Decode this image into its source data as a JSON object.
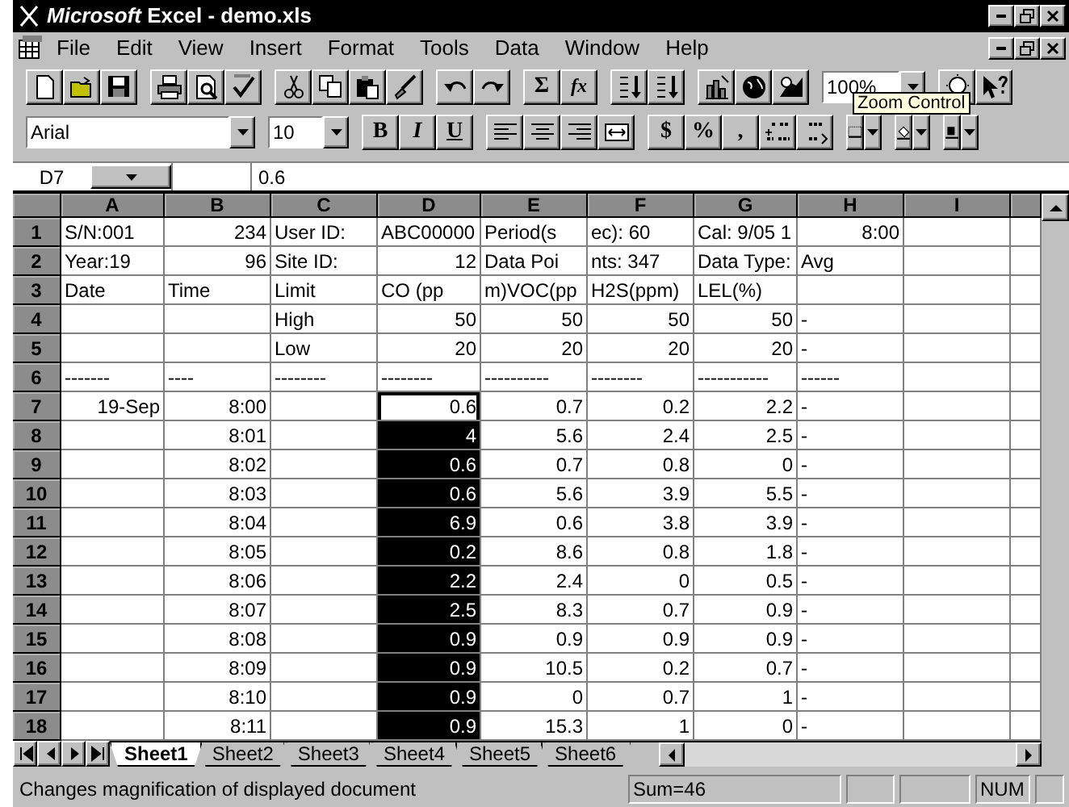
{
  "window": {
    "title": "*Microsoft* Excel - demo.xls"
  },
  "menu": [
    {
      "label": "File"
    },
    {
      "label": "Edit"
    },
    {
      "label": "View"
    },
    {
      "label": "Insert"
    },
    {
      "label": "Format"
    },
    {
      "label": "Tools"
    },
    {
      "label": "Data"
    },
    {
      "label": "Window"
    },
    {
      "label": "Help"
    }
  ],
  "standard_toolbar": {
    "sum_button": "Σ",
    "function_button": "fx",
    "zoom_box": "100%",
    "tooltip": "Zoom Control"
  },
  "formatting_toolbar": {
    "font_box": "Arial",
    "size_box": "10",
    "bold_button": "B",
    "italic_button": "I",
    "underline_button": "U",
    "currency_button": "$",
    "percent_button": "%",
    "comma_button": ","
  },
  "formula_bar": {
    "name_box": "D7",
    "value": "0.6"
  },
  "columns": [
    "A",
    "B",
    "C",
    "D",
    "E",
    "F",
    "G",
    "H",
    "I"
  ],
  "rows": [
    {
      "header": "1",
      "cells": [
        {
          "text": "S/N:001",
          "right": false,
          "selected": false,
          "active": false
        },
        {
          "text": "234",
          "right": true,
          "selected": false,
          "active": false
        },
        {
          "text": "User ID:",
          "right": false,
          "selected": false,
          "active": false
        },
        {
          "text": "ABC00000",
          "right": false,
          "selected": false,
          "active": false
        },
        {
          "text": "Period(s",
          "right": false,
          "selected": false,
          "active": false
        },
        {
          "text": "ec):  60",
          "right": false,
          "selected": false,
          "active": false
        },
        {
          "text": "Cal: 9/05 1",
          "right": false,
          "selected": false,
          "active": false
        },
        {
          "text": "8:00",
          "right": true,
          "selected": false,
          "active": false
        }
      ]
    },
    {
      "header": "2",
      "cells": [
        {
          "text": "Year:19",
          "right": false,
          "selected": false,
          "active": false
        },
        {
          "text": "96",
          "right": true,
          "selected": false,
          "active": false
        },
        {
          "text": "Site ID:",
          "right": false,
          "selected": false,
          "active": false
        },
        {
          "text": "12",
          "right": true,
          "selected": false,
          "active": false
        },
        {
          "text": "Data Poi",
          "right": false,
          "selected": false,
          "active": false
        },
        {
          "text": "nts: 347",
          "right": false,
          "selected": false,
          "active": false
        },
        {
          "text": "Data Type:",
          "right": false,
          "selected": false,
          "active": false
        },
        {
          "text": "Avg",
          "right": false,
          "selected": false,
          "active": false
        }
      ]
    },
    {
      "header": "3",
      "cells": [
        {
          "text": "Date",
          "right": false,
          "selected": false,
          "active": false
        },
        {
          "text": "Time",
          "right": false,
          "selected": false,
          "active": false
        },
        {
          "text": "Limit",
          "right": false,
          "selected": false,
          "active": false
        },
        {
          "text": "CO (pp",
          "right": false,
          "selected": false,
          "active": false
        },
        {
          "text": "m)VOC(pp",
          "right": false,
          "selected": false,
          "active": false
        },
        {
          "text": "H2S(ppm)",
          "right": false,
          "selected": false,
          "active": false
        },
        {
          "text": "LEL(%)",
          "right": false,
          "selected": false,
          "active": false
        },
        {
          "selected": false,
          "active": false
        }
      ]
    },
    {
      "header": "4",
      "cells": [
        {
          "selected": false,
          "active": false
        },
        {
          "selected": false,
          "active": false
        },
        {
          "text": "High",
          "right": false,
          "selected": false,
          "active": false
        },
        {
          "text": "50",
          "right": true,
          "selected": false,
          "active": false
        },
        {
          "text": "50",
          "right": true,
          "selected": false,
          "active": false
        },
        {
          "text": "50",
          "right": true,
          "selected": false,
          "active": false
        },
        {
          "text": "50",
          "right": true,
          "selected": false,
          "active": false
        },
        {
          "text": "-",
          "right": false,
          "selected": false,
          "active": false
        }
      ]
    },
    {
      "header": "5",
      "cells": [
        {
          "selected": false,
          "active": false
        },
        {
          "selected": false,
          "active": false
        },
        {
          "text": "Low",
          "right": false,
          "selected": false,
          "active": false
        },
        {
          "text": "20",
          "right": true,
          "selected": false,
          "active": false
        },
        {
          "text": "20",
          "right": true,
          "selected": false,
          "active": false
        },
        {
          "text": "20",
          "right": true,
          "selected": false,
          "active": false
        },
        {
          "text": "20",
          "right": true,
          "selected": false,
          "active": false
        },
        {
          "text": "-",
          "right": false,
          "selected": false,
          "active": false
        }
      ]
    },
    {
      "header": "6",
      "cells": [
        {
          "text": "-------",
          "right": false,
          "selected": false,
          "active": false
        },
        {
          "text": "----",
          "right": false,
          "selected": false,
          "active": false
        },
        {
          "text": "--------",
          "right": false,
          "selected": false,
          "active": false
        },
        {
          "text": "--------",
          "right": false,
          "selected": false,
          "active": false
        },
        {
          "text": "----------",
          "right": false,
          "selected": false,
          "active": false
        },
        {
          "text": "--------",
          "right": false,
          "selected": false,
          "active": false
        },
        {
          "text": "-----------",
          "right": false,
          "selected": false,
          "active": false
        },
        {
          "text": "------",
          "right": false,
          "selected": false,
          "active": false
        }
      ]
    },
    {
      "header": "7",
      "cells": [
        {
          "text": "19-Sep",
          "right": true,
          "selected": false,
          "active": false
        },
        {
          "text": "8:00",
          "right": true,
          "selected": false,
          "active": false
        },
        {
          "selected": false,
          "active": false
        },
        {
          "text": "0.6",
          "right": true,
          "selected": true,
          "active": true
        },
        {
          "text": "0.7",
          "right": true,
          "selected": false,
          "active": false
        },
        {
          "text": "0.2",
          "right": true,
          "selected": false,
          "active": false
        },
        {
          "text": "2.2",
          "right": true,
          "selected": false,
          "active": false
        },
        {
          "text": "-",
          "right": false,
          "selected": false,
          "active": false
        }
      ]
    },
    {
      "header": "8",
      "cells": [
        {
          "selected": false,
          "active": false
        },
        {
          "text": "8:01",
          "right": true,
          "selected": false,
          "active": false
        },
        {
          "selected": false,
          "active": false
        },
        {
          "text": "4",
          "right": true,
          "selected": true,
          "active": false
        },
        {
          "text": "5.6",
          "right": true,
          "selected": false,
          "active": false
        },
        {
          "text": "2.4",
          "right": true,
          "selected": false,
          "active": false
        },
        {
          "text": "2.5",
          "right": true,
          "selected": false,
          "active": false
        },
        {
          "text": "-",
          "right": false,
          "selected": false,
          "active": false
        }
      ]
    },
    {
      "header": "9",
      "cells": [
        {
          "selected": false,
          "active": false
        },
        {
          "text": "8:02",
          "right": true,
          "selected": false,
          "active": false
        },
        {
          "selected": false,
          "active": false
        },
        {
          "text": "0.6",
          "right": true,
          "selected": true,
          "active": false
        },
        {
          "text": "0.7",
          "right": true,
          "selected": false,
          "active": false
        },
        {
          "text": "0.8",
          "right": true,
          "selected": false,
          "active": false
        },
        {
          "text": "0",
          "right": true,
          "selected": false,
          "active": false
        },
        {
          "text": "-",
          "right": false,
          "selected": false,
          "active": false
        }
      ]
    },
    {
      "header": "10",
      "cells": [
        {
          "selected": false,
          "active": false
        },
        {
          "text": "8:03",
          "right": true,
          "selected": false,
          "active": false
        },
        {
          "selected": false,
          "active": false
        },
        {
          "text": "0.6",
          "right": true,
          "selected": true,
          "active": false
        },
        {
          "text": "5.6",
          "right": true,
          "selected": false,
          "active": false
        },
        {
          "text": "3.9",
          "right": true,
          "selected": false,
          "active": false
        },
        {
          "text": "5.5",
          "right": true,
          "selected": false,
          "active": false
        },
        {
          "text": "-",
          "right": false,
          "selected": false,
          "active": false
        }
      ]
    },
    {
      "header": "11",
      "cells": [
        {
          "selected": false,
          "active": false
        },
        {
          "text": "8:04",
          "right": true,
          "selected": false,
          "active": false
        },
        {
          "selected": false,
          "active": false
        },
        {
          "text": "6.9",
          "right": true,
          "selected": true,
          "active": false
        },
        {
          "text": "0.6",
          "right": true,
          "selected": false,
          "active": false
        },
        {
          "text": "3.8",
          "right": true,
          "selected": false,
          "active": false
        },
        {
          "text": "3.9",
          "right": true,
          "selected": false,
          "active": false
        },
        {
          "text": "-",
          "right": false,
          "selected": false,
          "active": false
        }
      ]
    },
    {
      "header": "12",
      "cells": [
        {
          "selected": false,
          "active": false
        },
        {
          "text": "8:05",
          "right": true,
          "selected": false,
          "active": false
        },
        {
          "selected": false,
          "active": false
        },
        {
          "text": "0.2",
          "right": true,
          "selected": true,
          "active": false
        },
        {
          "text": "8.6",
          "right": true,
          "selected": false,
          "active": false
        },
        {
          "text": "0.8",
          "right": true,
          "selected": false,
          "active": false
        },
        {
          "text": "1.8",
          "right": true,
          "selected": false,
          "active": false
        },
        {
          "text": "-",
          "right": false,
          "selected": false,
          "active": false
        }
      ]
    },
    {
      "header": "13",
      "cells": [
        {
          "selected": false,
          "active": false
        },
        {
          "text": "8:06",
          "right": true,
          "selected": false,
          "active": false
        },
        {
          "selected": false,
          "active": false
        },
        {
          "text": "2.2",
          "right": true,
          "selected": true,
          "active": false
        },
        {
          "text": "2.4",
          "right": true,
          "selected": false,
          "active": false
        },
        {
          "text": "0",
          "right": true,
          "selected": false,
          "active": false
        },
        {
          "text": "0.5",
          "right": true,
          "selected": false,
          "active": false
        },
        {
          "text": "-",
          "right": false,
          "selected": false,
          "active": false
        }
      ]
    },
    {
      "header": "14",
      "cells": [
        {
          "selected": false,
          "active": false
        },
        {
          "text": "8:07",
          "right": true,
          "selected": false,
          "active": false
        },
        {
          "selected": false,
          "active": false
        },
        {
          "text": "2.5",
          "right": true,
          "selected": true,
          "active": false
        },
        {
          "text": "8.3",
          "right": true,
          "selected": false,
          "active": false
        },
        {
          "text": "0.7",
          "right": true,
          "selected": false,
          "active": false
        },
        {
          "text": "0.9",
          "right": true,
          "selected": false,
          "active": false
        },
        {
          "text": "-",
          "right": false,
          "selected": false,
          "active": false
        }
      ]
    },
    {
      "header": "15",
      "cells": [
        {
          "selected": false,
          "active": false
        },
        {
          "text": "8:08",
          "right": true,
          "selected": false,
          "active": false
        },
        {
          "selected": false,
          "active": false
        },
        {
          "text": "0.9",
          "right": true,
          "selected": true,
          "active": false
        },
        {
          "text": "0.9",
          "right": true,
          "selected": false,
          "active": false
        },
        {
          "text": "0.9",
          "right": true,
          "selected": false,
          "active": false
        },
        {
          "text": "0.9",
          "right": true,
          "selected": false,
          "active": false
        },
        {
          "text": "-",
          "right": false,
          "selected": false,
          "active": false
        }
      ]
    },
    {
      "header": "16",
      "cells": [
        {
          "selected": false,
          "active": false
        },
        {
          "text": "8:09",
          "right": true,
          "selected": false,
          "active": false
        },
        {
          "selected": false,
          "active": false
        },
        {
          "text": "0.9",
          "right": true,
          "selected": true,
          "active": false
        },
        {
          "text": "10.5",
          "right": true,
          "selected": false,
          "active": false
        },
        {
          "text": "0.2",
          "right": true,
          "selected": false,
          "active": false
        },
        {
          "text": "0.7",
          "right": true,
          "selected": false,
          "active": false
        },
        {
          "text": "-",
          "right": false,
          "selected": false,
          "active": false
        }
      ]
    },
    {
      "header": "17",
      "cells": [
        {
          "selected": false,
          "active": false
        },
        {
          "text": "8:10",
          "right": true,
          "selected": false,
          "active": false
        },
        {
          "selected": false,
          "active": false
        },
        {
          "text": "0.9",
          "right": true,
          "selected": true,
          "active": false
        },
        {
          "text": "0",
          "right": true,
          "selected": false,
          "active": false
        },
        {
          "text": "0.7",
          "right": true,
          "selected": false,
          "active": false
        },
        {
          "text": "1",
          "right": true,
          "selected": false,
          "active": false
        },
        {
          "text": "-",
          "right": false,
          "selected": false,
          "active": false
        }
      ]
    },
    {
      "header": "18",
      "cells": [
        {
          "selected": false,
          "active": false
        },
        {
          "text": "8:11",
          "right": true,
          "selected": false,
          "active": false
        },
        {
          "selected": false,
          "active": false
        },
        {
          "text": "0.9",
          "right": true,
          "selected": true,
          "active": false
        },
        {
          "text": "15.3",
          "right": true,
          "selected": false,
          "active": false
        },
        {
          "text": "1",
          "right": true,
          "selected": false,
          "active": false
        },
        {
          "text": "0",
          "right": true,
          "selected": false,
          "active": false
        },
        {
          "text": "-",
          "right": false,
          "selected": false,
          "active": false
        }
      ]
    }
  ],
  "sheet_tabs": [
    {
      "label": "Sheet1",
      "selected": true
    },
    {
      "label": "Sheet2",
      "selected": false
    },
    {
      "label": "Sheet3",
      "selected": false
    },
    {
      "label": "Sheet4",
      "selected": false
    },
    {
      "label": "Sheet5",
      "selected": false
    },
    {
      "label": "Sheet6",
      "selected": false
    }
  ],
  "status_bar": {
    "message": "Changes magnification of displayed document",
    "sum": "Sum=46",
    "num_lock": "NUM"
  }
}
